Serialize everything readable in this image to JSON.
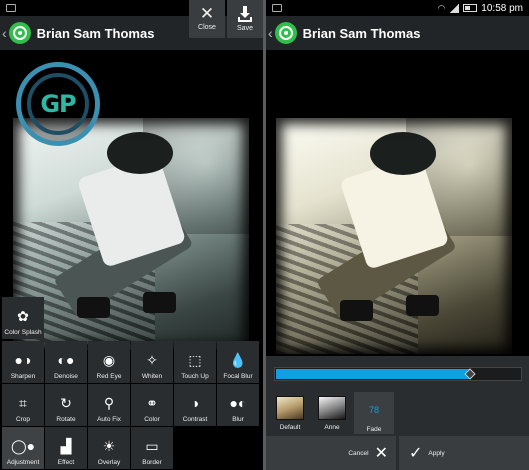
{
  "left": {
    "contact_name": "Brian Sam Thomas",
    "close_label": "Close",
    "save_label": "Save",
    "logo_text": "GP",
    "tools": [
      {
        "label": "Color Splash",
        "icon": "flower-icon"
      },
      {
        "label": "Sharpen",
        "icon": "sharpen-icon"
      },
      {
        "label": "Denoise",
        "icon": "denoise-icon"
      },
      {
        "label": "Red Eye",
        "icon": "eye-icon"
      },
      {
        "label": "Whiten",
        "icon": "sparkle-icon"
      },
      {
        "label": "Touch Up",
        "icon": "touch-up-icon"
      },
      {
        "label": "Focal Blur",
        "icon": "drops-icon"
      },
      {
        "label": "Crop",
        "icon": "crop-icon"
      },
      {
        "label": "Rotate",
        "icon": "rotate-icon"
      },
      {
        "label": "Auto Fix",
        "icon": "magic-wand-icon"
      },
      {
        "label": "Color",
        "icon": "color-circles-icon"
      },
      {
        "label": "Contrast",
        "icon": "contrast-icon"
      },
      {
        "label": "Blur",
        "icon": "blur-icon"
      },
      {
        "label": "Adjustment",
        "icon": "toggle-icon"
      },
      {
        "label": "Effect",
        "icon": "spray-icon"
      },
      {
        "label": "Overlay",
        "icon": "bulb-icon"
      },
      {
        "label": "Border",
        "icon": "frame-icon"
      }
    ]
  },
  "right": {
    "contact_name": "Brian Sam Thomas",
    "time": "10:58 pm",
    "slider_fraction": 0.79,
    "filters": [
      {
        "label": "Default"
      },
      {
        "label": "Anne"
      },
      {
        "label": "Fade",
        "value": "78"
      }
    ],
    "cancel_label": "Cancel",
    "apply_label": "Apply"
  },
  "colors": {
    "accent": "#0da0e3",
    "whatsapp": "#2fbf4a",
    "logo_ring": "#3b8fb0"
  }
}
